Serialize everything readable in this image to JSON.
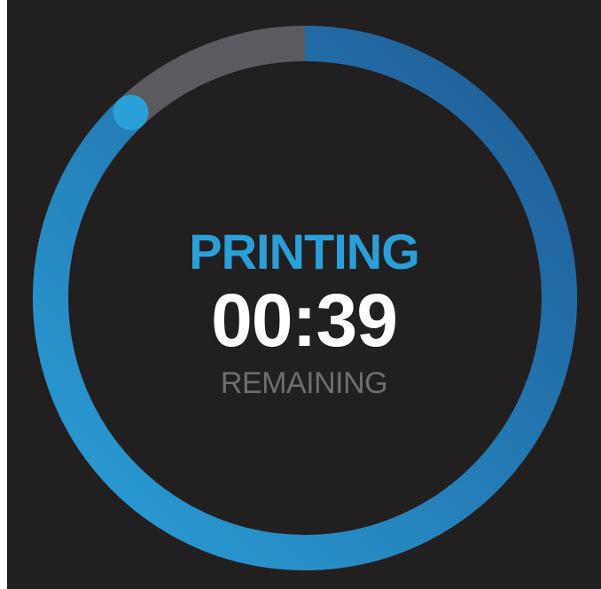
{
  "print_status": {
    "status_label": "PRINTING",
    "time_remaining": "00:39",
    "remaining_label": "REMAINING",
    "progress_fraction": 0.88
  },
  "colors": {
    "background": "#211f20",
    "track": "#5b5b5f",
    "progress_start": "#2a9fd8",
    "progress_end": "#1f5a94",
    "status_text": "#2a9fd8",
    "time_text": "#ffffff",
    "caption_text": "#6e6e6e"
  }
}
